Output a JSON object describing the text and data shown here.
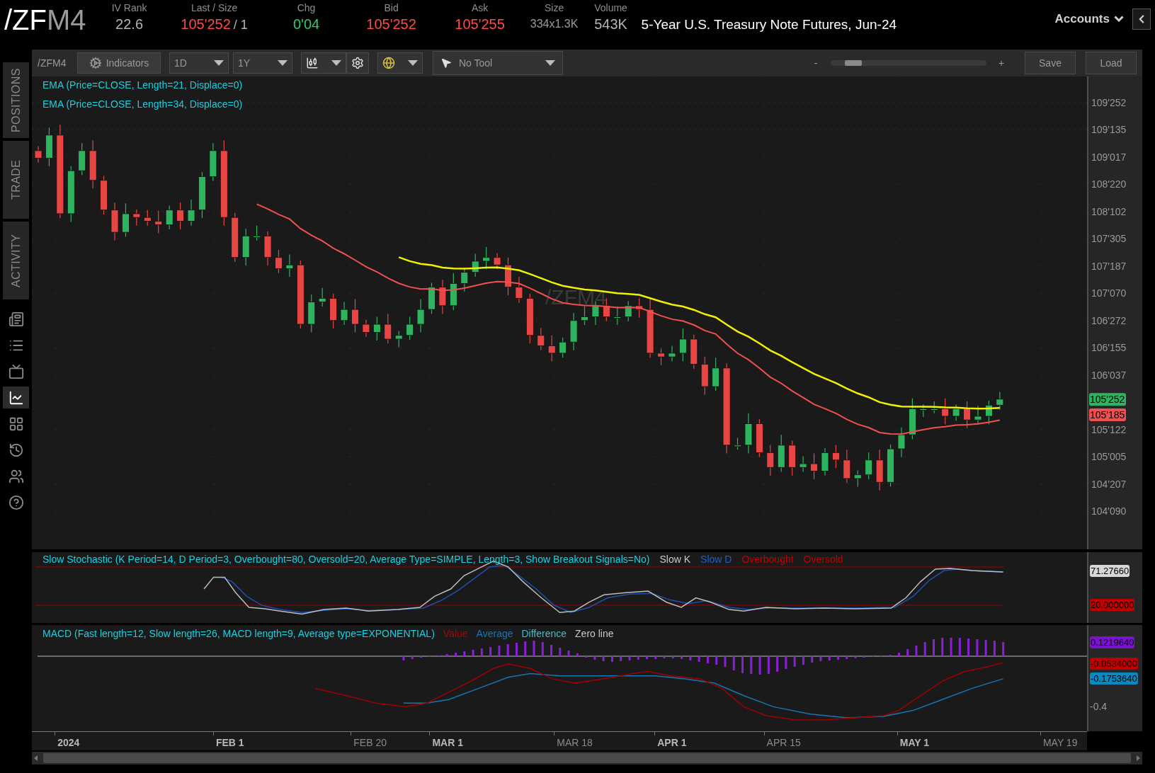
{
  "header": {
    "symbol_root": "/ZF",
    "symbol_month": "M4",
    "stats": [
      {
        "label": "IV Rank",
        "value": "22.6",
        "color": "#b4b4b4"
      },
      {
        "label": "Last / Size",
        "value": "105'252",
        "size": "/ 1",
        "color": "#ff4a4a"
      },
      {
        "label": "Chg",
        "value": "0'04",
        "color": "#2fcf6f"
      },
      {
        "label": "Bid",
        "value": "105'252",
        "color": "#ff4a4a"
      },
      {
        "label": "Ask",
        "value": "105'255",
        "color": "#ff4a4a"
      },
      {
        "label": "Size",
        "value": "334x1.3K",
        "color": "#9a9a9a"
      },
      {
        "label": "Volume",
        "value": "543K",
        "color": "#b4b4b4"
      }
    ],
    "description": "5-Year U.S. Treasury Note Futures, Jun-24",
    "accounts_button": "Accounts"
  },
  "sidebar": {
    "tabs": [
      {
        "label": "POSITIONS",
        "selected": false
      },
      {
        "label": "TRADE",
        "selected": false
      },
      {
        "label": "ACTIVITY",
        "selected": false
      }
    ],
    "icons": [
      {
        "kind": "news",
        "selected": false
      },
      {
        "kind": "list",
        "selected": false
      },
      {
        "kind": "tv",
        "selected": false
      },
      {
        "kind": "chart",
        "selected": true
      },
      {
        "kind": "grid",
        "selected": false
      },
      {
        "kind": "history",
        "selected": false
      },
      {
        "kind": "users",
        "selected": false
      },
      {
        "kind": "help",
        "selected": false
      }
    ]
  },
  "toolbar": {
    "symbol": "/ZFM4",
    "indicators_button": "Indicators",
    "aggregation": "1D",
    "period": "1Y",
    "drawing_tool": "No Tool",
    "zoom": {
      "minus": "-",
      "plus": "+",
      "level": 0.1
    },
    "buttons": [
      "Save",
      "Load"
    ]
  },
  "price_chart": {
    "legends": [
      "EMA (Price=CLOSE, Length=21, Displace=0)",
      "EMA (Price=CLOSE, Length=34, Displace=0)"
    ],
    "watermark": "/ZFM4",
    "axis_labels": [
      "109'252",
      "109'135",
      "109'017",
      "108'220",
      "108'102",
      "107'305",
      "107'187",
      "107'070",
      "106'272",
      "106'155",
      "106'037",
      "105'122",
      "105'005",
      "104'207",
      "104'090"
    ],
    "price_tags": [
      {
        "text": "105'252",
        "color": "#2eb35f"
      },
      {
        "text": "105'185",
        "color": "#f05050"
      }
    ]
  },
  "stochastic": {
    "legend": "Slow Stochastic (K Period=14, D Period=3, Overbought=80, Oversold=20, Average Type=SIMPLE, Length=3, Show Breakout Signals=No)",
    "series_labels": [
      {
        "text": "Slow K",
        "color": "#c8c8c8"
      },
      {
        "text": "Slow D",
        "color": "#1f5fd0"
      },
      {
        "text": "Overbought",
        "color": "#c00000"
      },
      {
        "text": "Oversold",
        "color": "#c00000"
      }
    ],
    "tags": [
      {
        "text": "71.27660",
        "color": "#d8d8d8"
      },
      {
        "text": "20.000000",
        "color": "#c00000"
      }
    ]
  },
  "macd": {
    "legend": "MACD (Fast length=12, Slow length=26, MACD length=9, Average type=EXPONENTIAL)",
    "series_labels": [
      {
        "text": "Value",
        "color": "#b00000"
      },
      {
        "text": "Average",
        "color": "#1577b5"
      },
      {
        "text": "Difference",
        "color": "#4ab8c8"
      },
      {
        "text": "Zero line",
        "color": "#c8c8c8"
      }
    ],
    "tags": [
      {
        "text": "0.1219640",
        "color": "#7a12d0"
      },
      {
        "text": "-0.0534000",
        "color": "#c00000"
      },
      {
        "text": "-0.1753640",
        "color": "#0a88c0"
      }
    ],
    "axis_label": "-0.4"
  },
  "date_axis": [
    "**2024**",
    "**FEB 1**",
    "FEB 20",
    "**MAR 1**",
    "MAR 18",
    "**APR 1**",
    "APR 15",
    "**MAY 1**",
    "MAY 19"
  ]
}
